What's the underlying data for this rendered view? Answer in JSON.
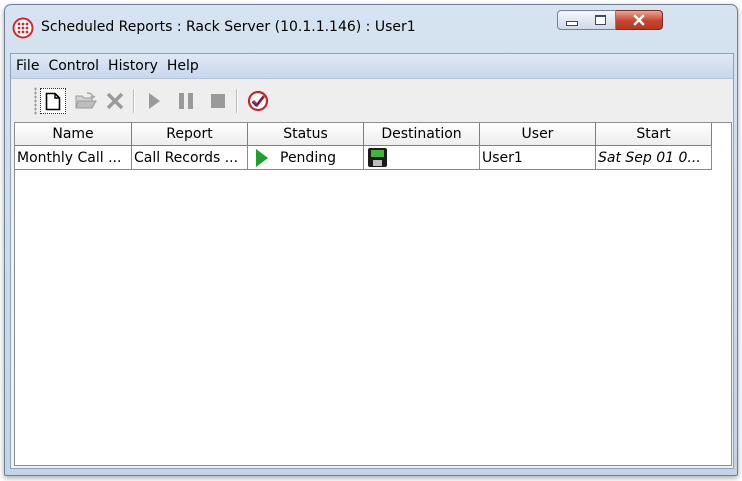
{
  "window": {
    "title": "Scheduled Reports : Rack Server (10.1.1.146) : User1"
  },
  "menu": [
    "File",
    "Control",
    "History",
    "Help"
  ],
  "toolbar": {
    "buttons": [
      "new-report",
      "open",
      "delete",
      "start",
      "pause",
      "stop",
      "check-schedule"
    ]
  },
  "table": {
    "headers": [
      "Name",
      "Report",
      "Status",
      "Destination",
      "User",
      "Start"
    ],
    "rows": [
      {
        "name": "Monthly Call ...",
        "report": "Call Records ...",
        "status": "Pending",
        "destination_icon": "floppy-disk-icon",
        "user": "User1",
        "start": "Sat Sep 01 0..."
      }
    ]
  },
  "colors": {
    "status_pending": "#1ea02a",
    "close_button": "#c7442c",
    "app_icon": "#d2272d"
  }
}
